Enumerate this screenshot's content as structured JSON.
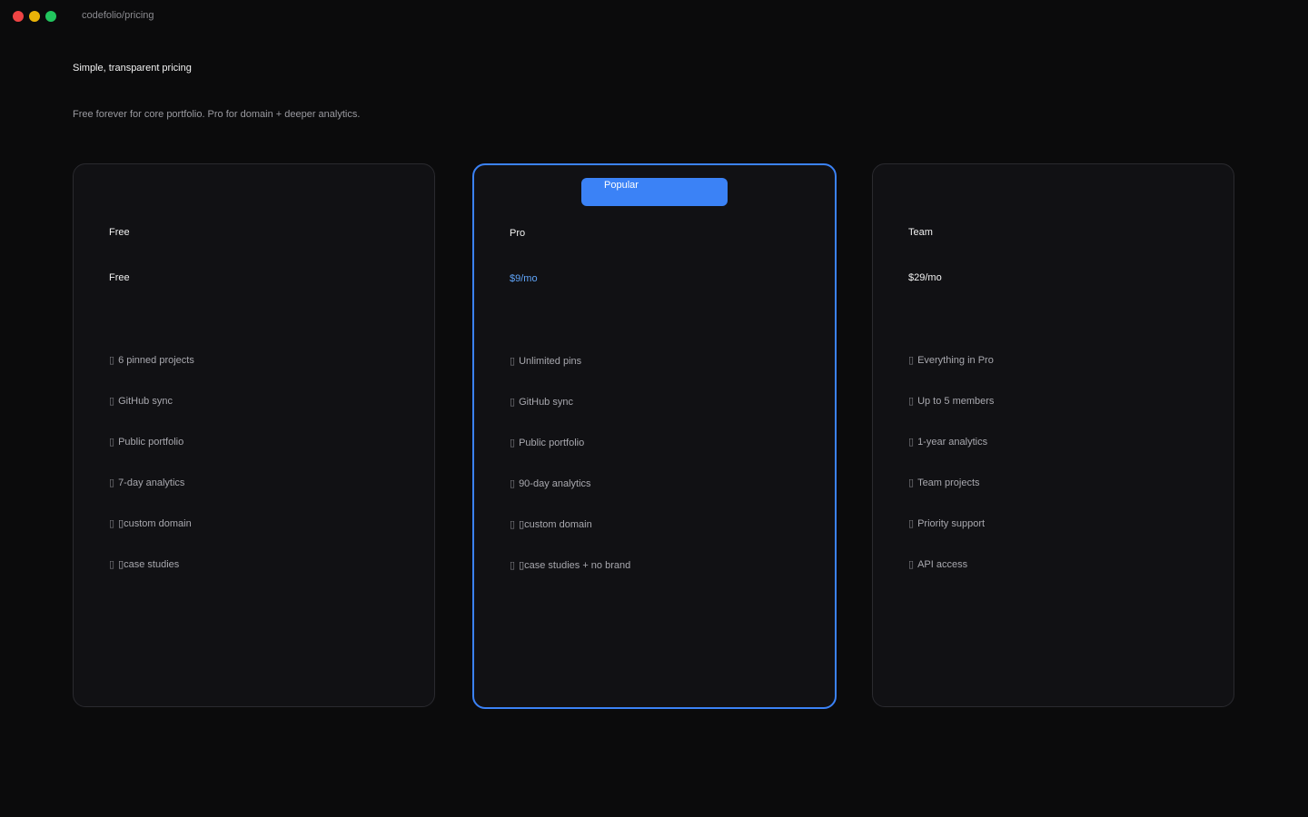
{
  "window": {
    "path": "codefolio/pricing"
  },
  "header": {
    "title": "Simple, transparent pricing",
    "subtitle": "Free forever for core portfolio. Pro for domain + deeper analytics."
  },
  "plans": [
    {
      "name": "Free",
      "price": "Free",
      "features": [
        "6 pinned projects",
        "GitHub sync",
        "Public portfolio",
        "7-day analytics",
        "▯custom domain",
        "▯case studies"
      ]
    },
    {
      "name": "Pro",
      "badge": "Popular",
      "price": "$9/mo",
      "accent": "#3b82f6",
      "features": [
        "Unlimited pins",
        "GitHub sync",
        "Public portfolio",
        "90-day analytics",
        "▯custom domain",
        "▯case studies + no brand"
      ]
    },
    {
      "name": "Team",
      "price": "$29/mo",
      "features": [
        "Everything in Pro",
        "Up to 5 members",
        "1-year analytics",
        "Team projects",
        "Priority support",
        "API access"
      ]
    }
  ],
  "icons": {
    "feature_bullet": "check-icon",
    "bullet_glyph": "▯"
  }
}
